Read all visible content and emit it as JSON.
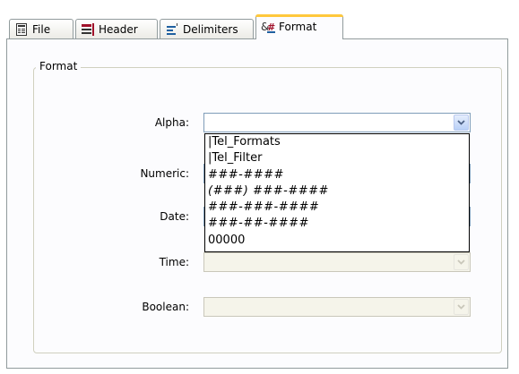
{
  "tabs": [
    {
      "label": "File",
      "icon": "file-icon",
      "active": false
    },
    {
      "label": "Header",
      "icon": "header-icon",
      "active": false
    },
    {
      "label": "Delimiters",
      "icon": "delimiters-icon",
      "active": false
    },
    {
      "label": "Format",
      "icon": "format-icon",
      "active": true
    }
  ],
  "group": {
    "label": "Format"
  },
  "fields": {
    "alpha": {
      "label": "Alpha:",
      "value": ""
    },
    "numeric": {
      "label": "Numeric:",
      "value": ""
    },
    "date": {
      "label": "Date:",
      "value": ""
    },
    "time": {
      "label": "Time:",
      "value": ""
    },
    "boolean": {
      "label": "Boolean:",
      "value": ""
    }
  },
  "alpha_dropdown": {
    "options": [
      "|Tel_Formats",
      "|Tel_Filter",
      "###-####",
      "(###) ###-####",
      "###-###-####",
      "###-##-####",
      "00000"
    ]
  },
  "colors": {
    "active_tab_accent": "#ffc83c",
    "combo_border": "#7f9db9",
    "disabled_bg": "#f5f4ea"
  }
}
